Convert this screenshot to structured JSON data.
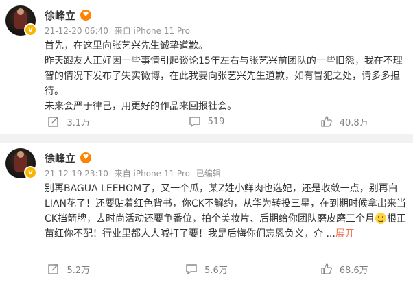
{
  "posts": [
    {
      "author": "徐峰立",
      "time": "21-12-20 06:40",
      "source": "来自 iPhone 11 Pro",
      "edited": "",
      "paragraphs": [
        "首先，在这里向张艺兴先生诚挚道歉。",
        "昨天跟友人正好因一些事情引起谈论15年左右与张艺兴前团队的一些旧怨，我在不理智的情况下发布了失实微博，在此我要向张艺兴先生道歉，如有冒犯之处，请多多担待。",
        "未来会严于律己，用更好的作品来回报社会。"
      ],
      "expand_label": "",
      "reposts": "3.1万",
      "comments": "519",
      "likes": "40.8万"
    },
    {
      "author": "徐峰立",
      "time": "21-12-19 23:10",
      "source": "来自 iPhone 11 Pro",
      "edited": "已编辑",
      "text_part1": "别再BAGUA LEEHOM了，又一个瓜，某Z姓小鲜肉也选妃，还是收敛一点，别再白LIAN花了！还要贴着红色背书，你CK不解约，从华为转投三星，在到期时候拿出来当CK挡箭牌，去时尚活动还要争番位，拍个美妆片、后期给你团队磨皮磨三个月",
      "text_part2": "根正苗红你不配！行业里都人人喊打了要！我是后悔你们忘恩负义，介 ...",
      "expand_label": "展开",
      "reposts": "5.2万",
      "comments": "5.6万",
      "likes": "68.6万"
    }
  ],
  "icons": {
    "repost": "repost-icon",
    "comment": "comment-icon",
    "like": "like-icon",
    "verified": "verified-badge-icon",
    "vip": "vip-badge-icon",
    "emoji": "sweat-smile-emoji-icon"
  },
  "colors": {
    "expand_link": "#eb7350",
    "verified_badge": "#f7b500",
    "vip_badge": "#ff8200",
    "meta_text": "#939393",
    "separator": "#f2f2f2"
  }
}
